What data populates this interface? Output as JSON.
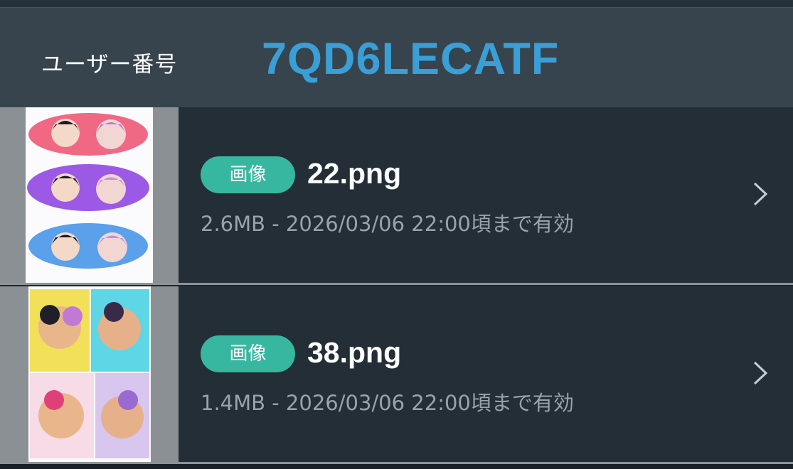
{
  "header": {
    "user_label": "ユーザー番号",
    "user_code": "7QD6LECATF"
  },
  "files": [
    {
      "badge": "画像",
      "name": "22.png",
      "meta": "2.6MB - 2026/03/06 22:00頃まで有効",
      "icon": "chevron-right-icon"
    },
    {
      "badge": "画像",
      "name": "38.png",
      "meta": "1.4MB - 2026/03/06 22:00頃まで有効",
      "icon": "chevron-right-icon"
    }
  ],
  "colors": {
    "background": "#1f282f",
    "header": "#37444d",
    "accent": "#3a9fd6",
    "badge": "#38b7a0"
  }
}
